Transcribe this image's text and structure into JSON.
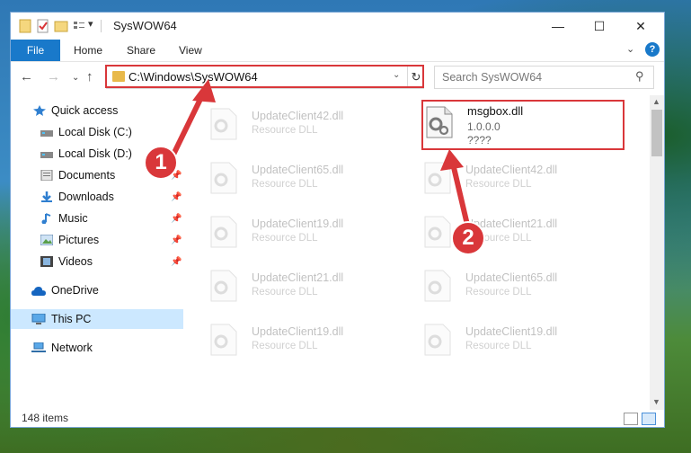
{
  "window": {
    "title": "SysWOW64"
  },
  "titlebar": {
    "minimize": "—",
    "maximize": "☐",
    "close": "✕",
    "quick_access_down": "▾"
  },
  "ribbon": {
    "file": "File",
    "home": "Home",
    "share": "Share",
    "view": "View",
    "collapse": "⌄",
    "help": "?"
  },
  "nav": {
    "back": "←",
    "forward": "→",
    "recent": "⌄",
    "up": "↑"
  },
  "address": {
    "path": "C:\\Windows\\SysWOW64",
    "dropdown": "⌄",
    "refresh": "↻"
  },
  "search": {
    "placeholder": "Search SysWOW64",
    "icon": "⚲"
  },
  "sidebar": {
    "items": [
      {
        "label": "Quick access",
        "icon": "star-icon"
      },
      {
        "label": "Local Disk (C:)",
        "icon": "drive-icon"
      },
      {
        "label": "Local Disk (D:)",
        "icon": "drive-icon"
      },
      {
        "label": "Documents",
        "icon": "documents-icon",
        "pinned": true
      },
      {
        "label": "Downloads",
        "icon": "downloads-icon",
        "pinned": true
      },
      {
        "label": "Music",
        "icon": "music-icon",
        "pinned": true
      },
      {
        "label": "Pictures",
        "icon": "pictures-icon",
        "pinned": true
      },
      {
        "label": "Videos",
        "icon": "videos-icon",
        "pinned": true
      },
      {
        "label": "OneDrive",
        "icon": "cloud-icon"
      },
      {
        "label": "This PC",
        "icon": "computer-icon"
      },
      {
        "label": "Network",
        "icon": "network-icon"
      }
    ],
    "pin": "📌"
  },
  "files": {
    "left": [
      {
        "name": "UpdateClient42.dll",
        "desc": "Resource DLL"
      },
      {
        "name": "UpdateClient65.dll",
        "desc": "Resource DLL"
      },
      {
        "name": "UpdateClient19.dll",
        "desc": "Resource DLL"
      },
      {
        "name": "UpdateClient21.dll",
        "desc": "Resource DLL"
      },
      {
        "name": "UpdateClient19.dll",
        "desc": "Resource DLL"
      }
    ],
    "right": [
      {
        "name": "UpdateClient42.dll",
        "desc": "Resource DLL"
      },
      {
        "name": "UpdateClient21.dll",
        "desc": "Resource DLL"
      },
      {
        "name": "UpdateClient65.dll",
        "desc": "Resource DLL"
      },
      {
        "name": "UpdateClient19.dll",
        "desc": "Resource DLL"
      }
    ],
    "selected": {
      "name": "msgbox.dll",
      "version": "1.0.0.0",
      "desc": "????"
    }
  },
  "status": {
    "items": "148 items"
  },
  "annotations": {
    "step1": "1",
    "step2": "2",
    "color": "#d9373a"
  }
}
